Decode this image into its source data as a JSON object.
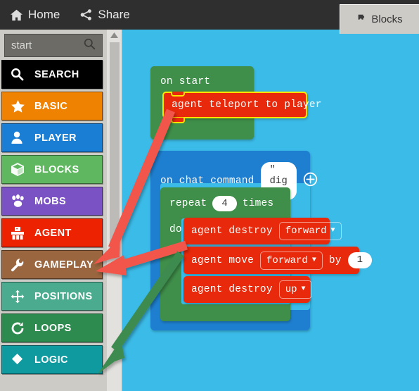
{
  "topbar": {
    "items": [
      {
        "label": "Home",
        "icon": "home-icon"
      },
      {
        "label": "Share",
        "icon": "share-icon"
      }
    ],
    "tab": {
      "label": "Blocks",
      "icon": "puzzle-piece-icon"
    }
  },
  "toolbox": {
    "search": {
      "value": "start",
      "placeholder": "",
      "icon": "search-icon"
    },
    "categories": [
      {
        "label": "SEARCH",
        "icon": "magnifier-icon",
        "color": "#000000"
      },
      {
        "label": "BASIC",
        "icon": "star-icon",
        "color": "#ef8200"
      },
      {
        "label": "PLAYER",
        "icon": "person-icon",
        "color": "#1a7fd4"
      },
      {
        "label": "BLOCKS",
        "icon": "cube-icon",
        "color": "#5fb860"
      },
      {
        "label": "MOBS",
        "icon": "paw-icon",
        "color": "#7b52c4"
      },
      {
        "label": "AGENT",
        "icon": "robot-icon",
        "color": "#ec2200"
      },
      {
        "label": "GAMEPLAY",
        "icon": "wrench-icon",
        "color": "#9a6640"
      },
      {
        "label": "POSITIONS",
        "icon": "move-arrows-icon",
        "color": "#4bab8e"
      },
      {
        "label": "LOOPS",
        "icon": "refresh-icon",
        "color": "#2e8b4f"
      },
      {
        "label": "LOGIC",
        "icon": "logic-icon",
        "color": "#0f9aa0"
      }
    ],
    "scrollbar": {
      "up_arrow": "scroll-up-arrow"
    }
  },
  "workspace": {
    "background_color": "#3bbbe8",
    "blocks": {
      "on_start": {
        "label": "on start",
        "color": "#3f8f4a",
        "child": {
          "label": "agent teleport to player",
          "color": "#e8290b",
          "selected": true,
          "highlight_color": "#ffe400"
        }
      },
      "on_chat_command": {
        "label": "on chat command",
        "color": "#1e7fd0",
        "command_value": "\" dig \"",
        "add_icon": "plus-circle-icon",
        "repeat": {
          "label_start": "repeat",
          "count": "4",
          "label_end": "times",
          "do_label": "do",
          "color": "#3f8f4a",
          "statements": [
            {
              "label": "agent destroy",
              "dropdown": "forward",
              "color": "#e8290b"
            },
            {
              "label": "agent move",
              "dropdown": "forward",
              "suffix": "by",
              "value": "1",
              "color": "#e8290b"
            },
            {
              "label": "agent destroy",
              "dropdown": "up",
              "color": "#e8290b"
            }
          ]
        }
      }
    }
  },
  "annotations": {
    "arrows": [
      {
        "name": "arrow-to-agent-upper",
        "color": "#f2564b",
        "target": "AGENT"
      },
      {
        "name": "arrow-to-agent-lower",
        "color": "#f2564b",
        "target": "AGENT"
      },
      {
        "name": "arrow-to-loops",
        "color": "#3d8b4f",
        "target": "LOOPS"
      }
    ]
  }
}
